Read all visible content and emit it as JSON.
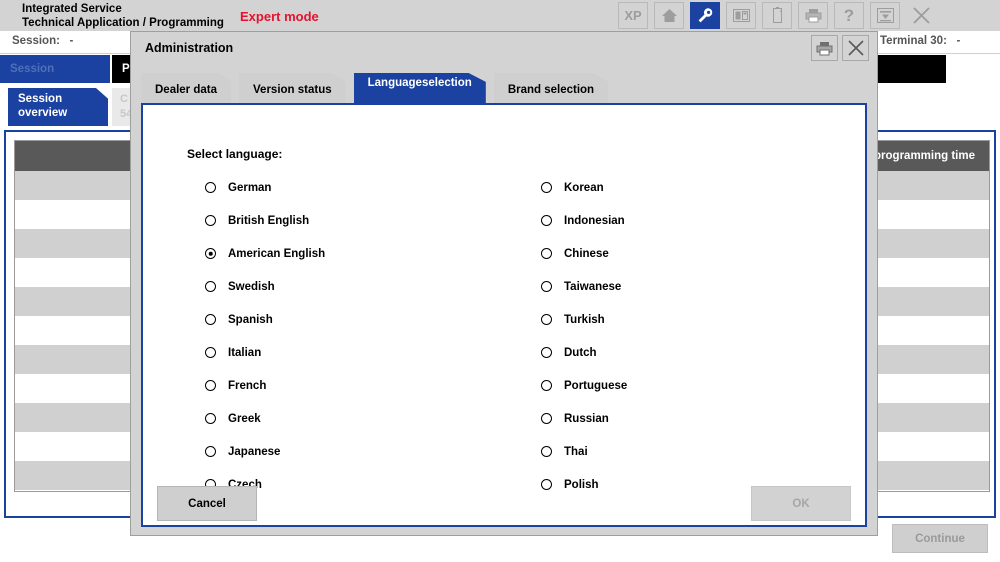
{
  "app": {
    "title_line1": "Integrated Service",
    "title_line2": "Technical Application / Programming",
    "expert_mode": "Expert mode",
    "toolbar": [
      {
        "name": "xp-icon",
        "label": "XP",
        "active": false
      },
      {
        "name": "home-icon",
        "label": "",
        "active": false
      },
      {
        "name": "wrench-icon",
        "label": "",
        "active": true
      },
      {
        "name": "two-panel-icon",
        "label": "",
        "active": false
      },
      {
        "name": "battery-icon",
        "label": "",
        "active": false
      },
      {
        "name": "printer-icon",
        "label": "",
        "active": false
      },
      {
        "name": "help-icon",
        "label": "?",
        "active": false
      },
      {
        "name": "download-tray-icon",
        "label": "",
        "active": false
      },
      {
        "name": "close-icon",
        "label": "",
        "active": false
      }
    ]
  },
  "status": {
    "session_label": "Session:",
    "session_value": "-",
    "terminal_label": "Terminal 30:",
    "terminal_value": "-"
  },
  "nav": {
    "tab_session": "Session",
    "tab_programming": "Pr",
    "subtab_session_overview": "Session overview",
    "subtab_ghost_line1": "C",
    "subtab_ghost_line2": "54"
  },
  "table": {
    "header_right": "g programming time",
    "row_count": 11
  },
  "footer": {
    "continue_label": "Continue"
  },
  "dialog": {
    "title": "Administration",
    "header_buttons": [
      {
        "name": "print-icon",
        "label": ""
      },
      {
        "name": "close-icon",
        "label": ""
      }
    ],
    "tabs": [
      {
        "label": "Dealer data",
        "active": false,
        "two_line": false
      },
      {
        "label": "Version status",
        "active": false,
        "two_line": false
      },
      {
        "label": "Language\nselection",
        "line1": "Language",
        "line2": "selection",
        "active": true,
        "two_line": true
      },
      {
        "label": "Brand selection",
        "active": false,
        "two_line": false
      }
    ],
    "select_label": "Select language:",
    "languages_left": [
      {
        "label": "German",
        "selected": false
      },
      {
        "label": "British English",
        "selected": false
      },
      {
        "label": "American English",
        "selected": true
      },
      {
        "label": "Swedish",
        "selected": false
      },
      {
        "label": "Spanish",
        "selected": false
      },
      {
        "label": "Italian",
        "selected": false
      },
      {
        "label": "French",
        "selected": false
      },
      {
        "label": "Greek",
        "selected": false
      },
      {
        "label": "Japanese",
        "selected": false
      },
      {
        "label": "Czech",
        "selected": false
      }
    ],
    "languages_right": [
      {
        "label": "Korean",
        "selected": false
      },
      {
        "label": "Indonesian",
        "selected": false
      },
      {
        "label": "Chinese",
        "selected": false
      },
      {
        "label": "Taiwanese",
        "selected": false
      },
      {
        "label": "Turkish",
        "selected": false
      },
      {
        "label": "Dutch",
        "selected": false
      },
      {
        "label": "Portuguese",
        "selected": false
      },
      {
        "label": "Russian",
        "selected": false
      },
      {
        "label": "Thai",
        "selected": false
      },
      {
        "label": "Polish",
        "selected": false
      }
    ],
    "cancel_label": "Cancel",
    "ok_label": "OK",
    "ok_enabled": false
  },
  "colors": {
    "brand_blue": "#1b42a0",
    "expert_red": "#e8112d",
    "chrome_gray": "#d3d3d3",
    "row_alt": "#d0d0d0",
    "table_header": "#595959"
  }
}
